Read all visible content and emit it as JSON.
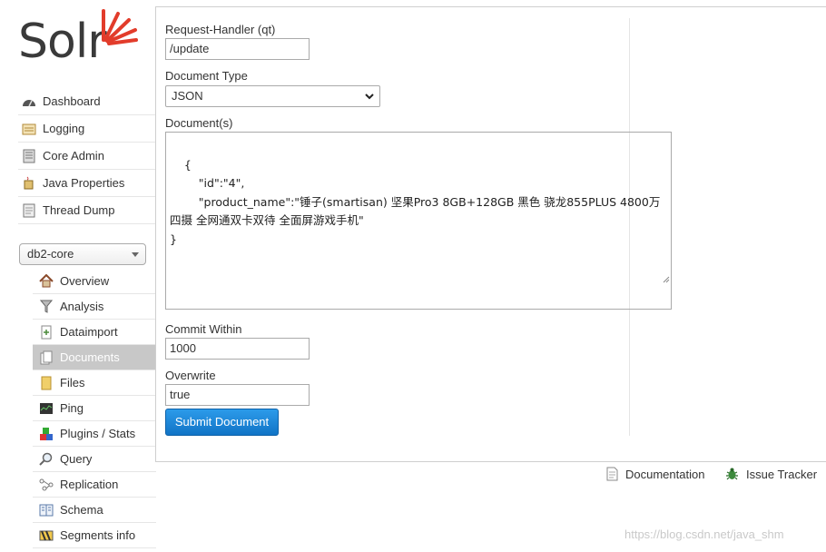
{
  "logo": {
    "text": "Solr"
  },
  "main_menu": [
    {
      "label": "Dashboard",
      "icon": "dashboard-icon"
    },
    {
      "label": "Logging",
      "icon": "logging-icon"
    },
    {
      "label": "Core Admin",
      "icon": "core-admin-icon"
    },
    {
      "label": "Java Properties",
      "icon": "java-icon"
    },
    {
      "label": "Thread Dump",
      "icon": "thread-dump-icon"
    }
  ],
  "core_selector": {
    "value": "db2-core"
  },
  "core_menu": [
    {
      "label": "Overview",
      "icon": "house-icon"
    },
    {
      "label": "Analysis",
      "icon": "funnel-icon"
    },
    {
      "label": "Dataimport",
      "icon": "dataimport-icon"
    },
    {
      "label": "Documents",
      "icon": "documents-icon",
      "active": true
    },
    {
      "label": "Files",
      "icon": "folder-icon"
    },
    {
      "label": "Ping",
      "icon": "ping-icon"
    },
    {
      "label": "Plugins / Stats",
      "icon": "plugins-icon"
    },
    {
      "label": "Query",
      "icon": "magnifier-icon"
    },
    {
      "label": "Replication",
      "icon": "replication-icon"
    },
    {
      "label": "Schema",
      "icon": "schema-icon"
    },
    {
      "label": "Segments info",
      "icon": "segments-icon"
    }
  ],
  "form": {
    "request_handler_label": "Request-Handler (qt)",
    "request_handler_value": "/update",
    "doc_type_label": "Document Type",
    "doc_type_value": "JSON",
    "documents_label": "Document(s)",
    "documents_value": "{\n        \"id\":\"4\",\n        \"product_name\":\"锤子(smartisan) 坚果Pro3 8GB+128GB 黑色 骁龙855PLUS 4800万四摄 全网通双卡双待 全面屏游戏手机\"\n}",
    "commit_within_label": "Commit Within",
    "commit_within_value": "1000",
    "overwrite_label": "Overwrite",
    "overwrite_value": "true",
    "submit_label": "Submit Document"
  },
  "footer": {
    "documentation": "Documentation",
    "issue_tracker": "Issue Tracker"
  },
  "watermark": "https://blog.csdn.net/java_shm",
  "colors": {
    "accent": "#1a82d6",
    "logo_red": "#e23c2b",
    "active_item": "#c8c8c8"
  }
}
